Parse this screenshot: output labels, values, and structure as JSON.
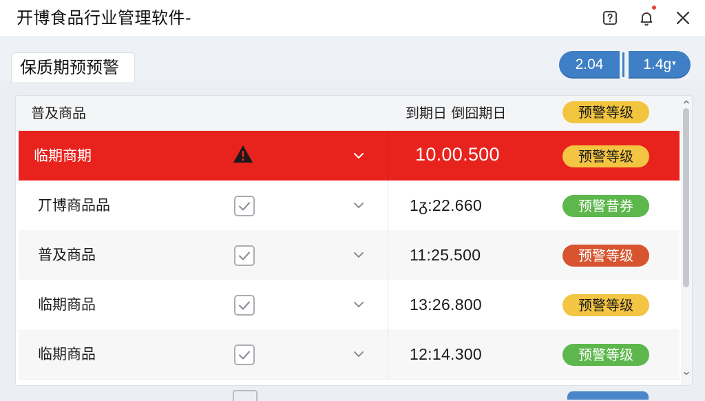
{
  "window": {
    "title": "开博食品行业管理软件-"
  },
  "tabs": [
    {
      "label": "保质期预预警"
    }
  ],
  "toolbar": {
    "pills": [
      {
        "label": "2.04"
      },
      {
        "label": "1.4g"
      }
    ],
    "pill_caret": "▾"
  },
  "table": {
    "headers": {
      "name": "普及商品",
      "date": "到期日  倒囧期日",
      "level": "预警等级"
    },
    "rows": [
      {
        "name": "临期商期",
        "time": "10.00.500",
        "level": "预警等级",
        "level_color": "yellow",
        "status": "alert"
      },
      {
        "name": "丌博商品品",
        "time": "1ᵹ:22.660",
        "level": "预警昔券",
        "level_color": "green",
        "status": "normal"
      },
      {
        "name": "普及商品",
        "time": "11:25.500",
        "level": "预警等级",
        "level_color": "orange",
        "status": "normal"
      },
      {
        "name": "临期商品",
        "time": "13:26.800",
        "level": "预警等级",
        "level_color": "yellow",
        "status": "normal"
      },
      {
        "name": "临期商品",
        "time": "12:14.300",
        "level": "预警等级",
        "level_color": "green",
        "status": "normal"
      }
    ]
  },
  "colors": {
    "alert_row": "#e8231d",
    "yellow_tag": "#f4c542",
    "green_tag": "#5db74c",
    "orange_tag": "#d7542f",
    "pill_blue": "#3f7fc5"
  },
  "icons": {
    "help": "help-icon",
    "bell": "bell-icon",
    "close": "close-icon",
    "warning": "warning-triangle-icon",
    "checkbox": "checkbox-checked-icon",
    "chevron": "chevron-down-icon"
  }
}
